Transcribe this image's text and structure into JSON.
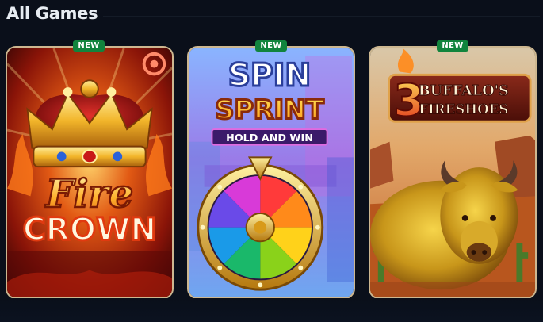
{
  "section": {
    "title": "All Games"
  },
  "games": [
    {
      "badge": "NEW",
      "logo_line1": "Fire",
      "logo_line2": "CROWN"
    },
    {
      "badge": "NEW",
      "logo_line1": "SPIN",
      "logo_line2": "SPRINT",
      "tagline": "HOLD AND WIN"
    },
    {
      "badge": "NEW",
      "number": "3",
      "logo_line1": "BUFFALO'S",
      "logo_line2": "FIRESHOES"
    }
  ],
  "colors": {
    "background": "#0a0f1a",
    "badge": "#11843d",
    "card_border": "#cdb790"
  }
}
